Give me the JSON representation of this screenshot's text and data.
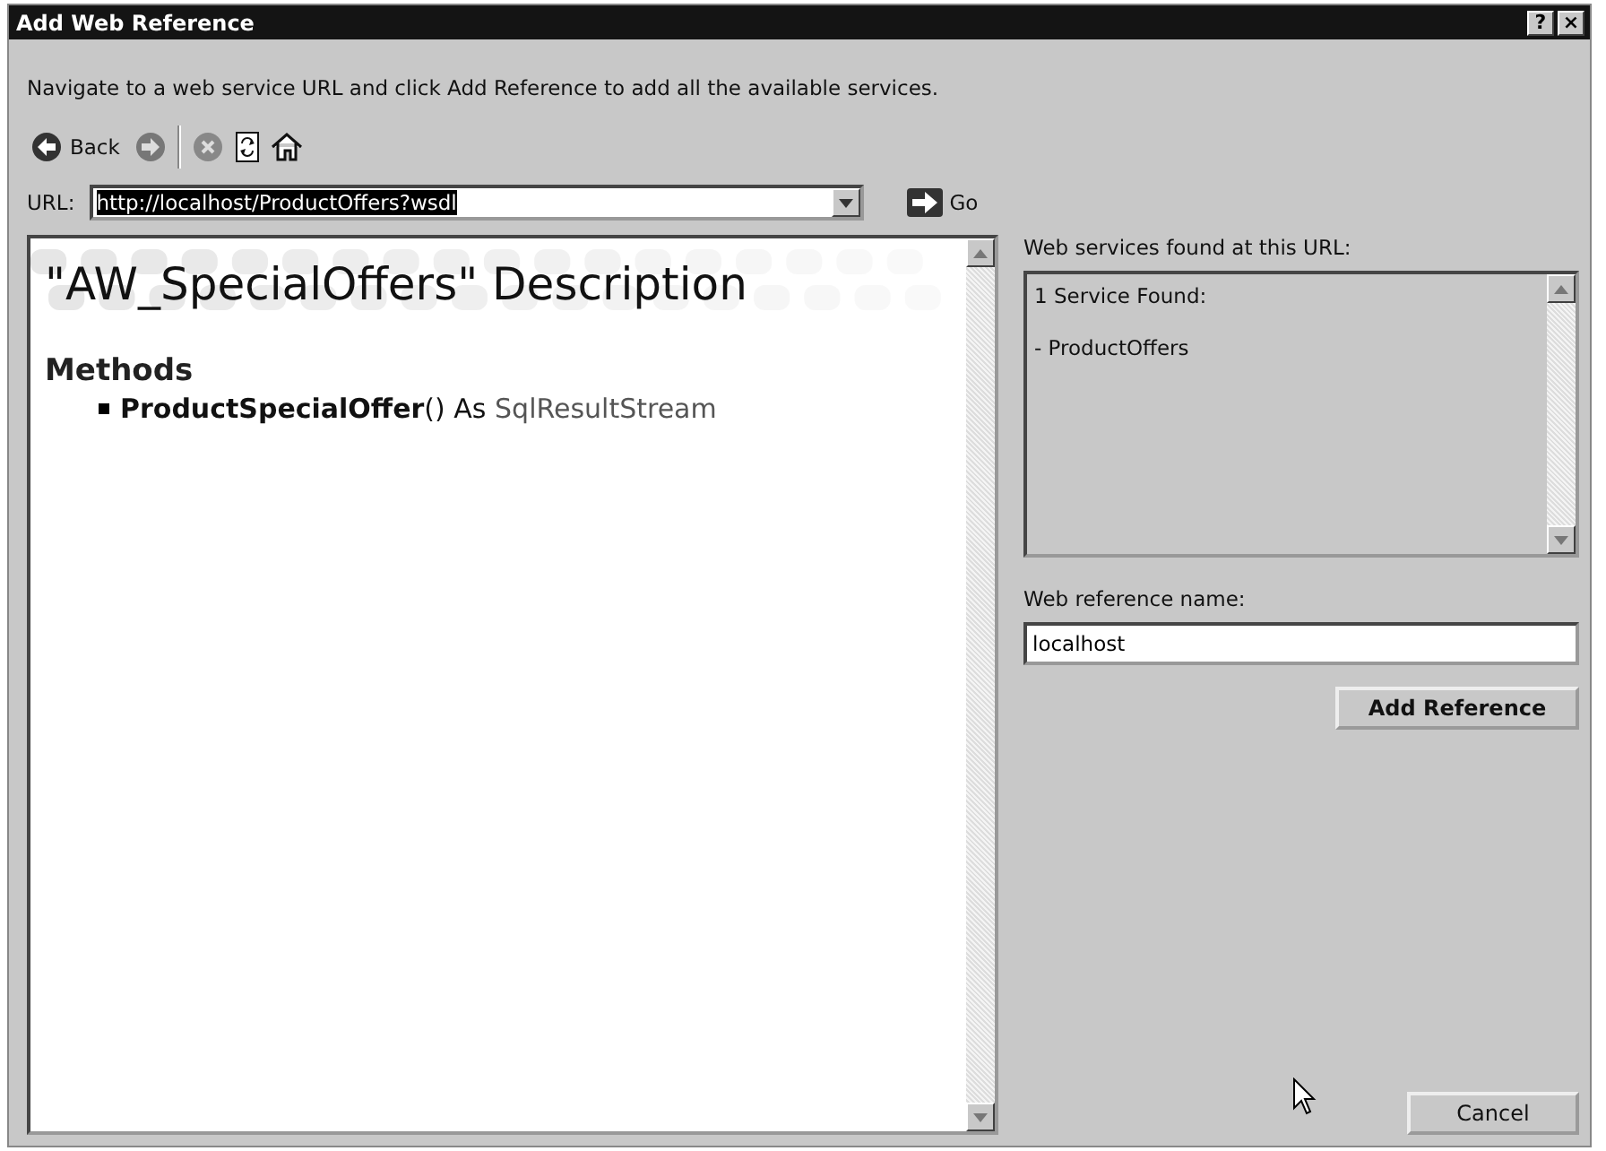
{
  "window": {
    "title": "Add Web Reference",
    "help_button": "?",
    "close_button": "×"
  },
  "instruction": "Navigate to a web service URL and click Add Reference to add all the available services.",
  "toolbar": {
    "back_label": "Back"
  },
  "url": {
    "label": "URL:",
    "value": "http://localhost/ProductOffers?wsdl",
    "go_label": "Go"
  },
  "description": {
    "title": "\"AW_SpecialOffers\" Description",
    "methods_heading": "Methods",
    "methods": [
      {
        "name": "ProductSpecialOffer",
        "signature": "()",
        "as": "As",
        "type": "SqlResultStream"
      }
    ]
  },
  "services": {
    "label": "Web services found at this URL:",
    "lines": [
      "1 Service Found:",
      "- ProductOffers"
    ]
  },
  "reference_name": {
    "label": "Web reference name:",
    "value": "localhost"
  },
  "buttons": {
    "add": "Add Reference",
    "cancel": "Cancel"
  }
}
